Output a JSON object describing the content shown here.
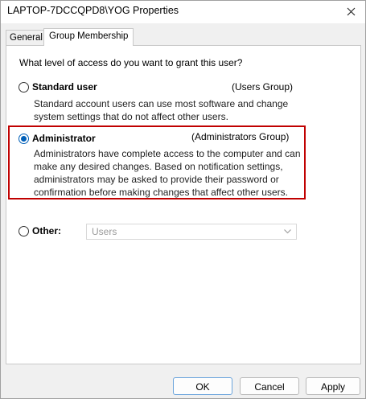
{
  "window": {
    "title": "LAPTOP-7DCCQPD8\\YOG Properties"
  },
  "tabs": [
    {
      "label": "General",
      "active": false
    },
    {
      "label": "Group Membership",
      "active": true
    }
  ],
  "question": "What level of access do you want to grant this user?",
  "options": {
    "standard": {
      "label": "Standard user",
      "group": "(Users Group)",
      "description": "Standard account users can use most software and change system settings that do not affect other users.",
      "checked": false
    },
    "administrator": {
      "label": "Administrator",
      "group": "(Administrators Group)",
      "description": "Administrators have complete access to the computer and can make any desired changes. Based on notification settings, administrators may be asked to provide their password or confirmation before making changes that affect other users.",
      "checked": true
    },
    "other": {
      "label": "Other:",
      "select_value": "Users",
      "checked": false
    }
  },
  "buttons": {
    "ok": "OK",
    "cancel": "Cancel",
    "apply": "Apply"
  },
  "colors": {
    "highlight": "#c00000",
    "accent": "#005fb8"
  },
  "icons": [
    "close-icon",
    "chevron-down-icon"
  ]
}
